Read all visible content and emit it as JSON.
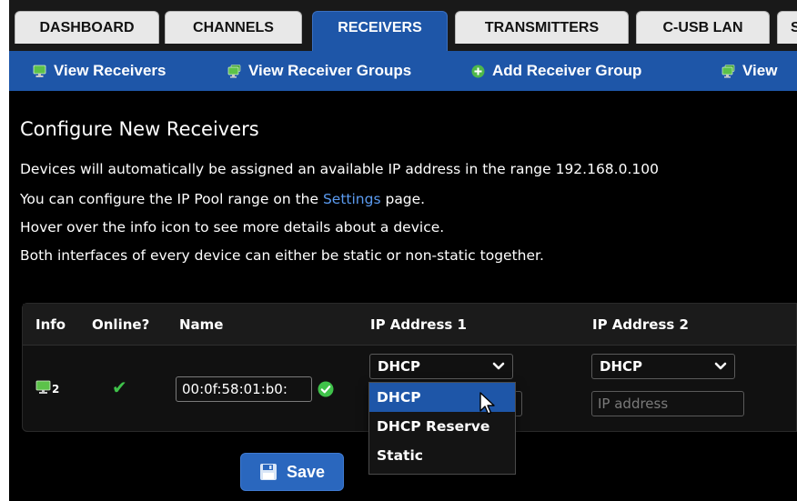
{
  "tabs": [
    {
      "label": "DASHBOARD"
    },
    {
      "label": "CHANNELS"
    },
    {
      "label": "RECEIVERS"
    },
    {
      "label": "TRANSMITTERS"
    },
    {
      "label": "C-USB LAN"
    },
    {
      "label": "S"
    }
  ],
  "active_tab": "RECEIVERS",
  "subnav": [
    {
      "label": "View Receivers",
      "icon": "monitor-icon"
    },
    {
      "label": "View Receiver Groups",
      "icon": "monitor-group-icon"
    },
    {
      "label": "Add Receiver Group",
      "icon": "plus-circle-icon"
    },
    {
      "label": "View",
      "icon": "monitor-group-icon"
    }
  ],
  "page": {
    "title": "Configure New Receivers",
    "line1": "Devices will automatically be assigned an available IP address in the range 192.168.0.100",
    "line2_pre": "You can configure the IP Pool range on the ",
    "line2_link": "Settings",
    "line2_post": " page.",
    "line3": "Hover over the info icon to see more details about a device.",
    "line4": "Both interfaces of every device can either be static or non-static together."
  },
  "table": {
    "headers": [
      "Info",
      "Online?",
      "Name",
      "IP Address 1",
      "IP Address 2"
    ],
    "row": {
      "info_count": "2",
      "online": "✔",
      "name": "00:0f:58:01:b0:",
      "ip1_mode": "DHCP",
      "ip2_mode": "DHCP",
      "ip2_placeholder": "IP address"
    }
  },
  "dropdown": {
    "options": [
      "DHCP",
      "DHCP Reserve",
      "Static"
    ],
    "highlighted": "DHCP"
  },
  "save_label": "Save",
  "colors": {
    "accent_blue": "#1e56a8",
    "link_blue": "#5b9bf0",
    "success_green": "#3fc24a",
    "monitor_green": "#5cc24a"
  }
}
